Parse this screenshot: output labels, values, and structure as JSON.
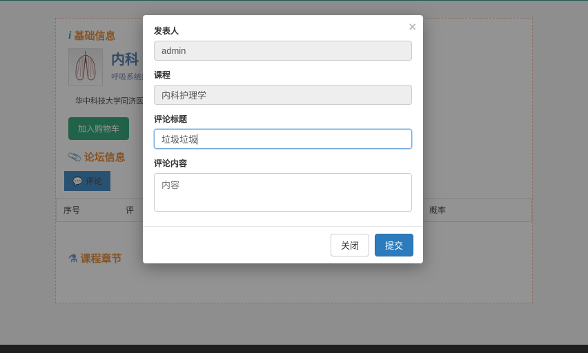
{
  "sections": {
    "basic_info": "基础信息",
    "forum_info": "论坛信息",
    "course_chapters": "课程章节"
  },
  "course": {
    "name": "内科",
    "subtitle": "呼吸系统病",
    "provider": "华中科技大学同济医"
  },
  "buttons": {
    "add_to_cart": "加入购物车",
    "comment": "评论"
  },
  "table": {
    "col_index": "序号",
    "col_comment": "评",
    "col_rate": "概率"
  },
  "modal": {
    "labels": {
      "author": "发表人",
      "course": "课程",
      "title": "评论标题",
      "content": "评论内容"
    },
    "values": {
      "author": "admin",
      "course": "内科护理学",
      "title": "垃圾垃圾"
    },
    "placeholders": {
      "content": "内容"
    },
    "close": "关闭",
    "submit": "提交"
  }
}
